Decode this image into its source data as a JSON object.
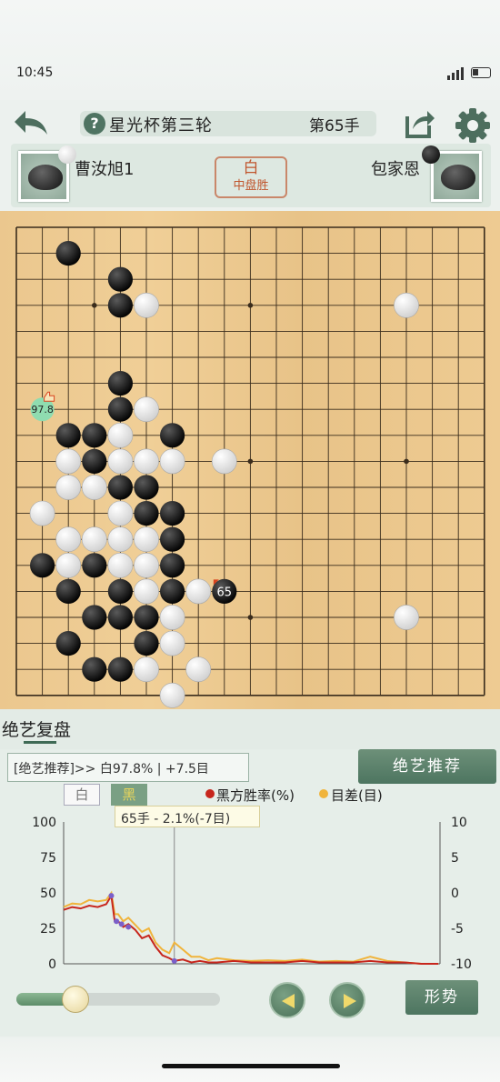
{
  "status": {
    "time": "10:45"
  },
  "header": {
    "title": "星光杯第三轮",
    "move_label": "第65手",
    "help_icon": "?",
    "icons": [
      "back-arrow-icon",
      "share-icon",
      "gear-icon",
      "help-icon"
    ]
  },
  "players": {
    "white": {
      "name": "曹汝旭1",
      "stone": "white"
    },
    "black": {
      "name": "包家恩",
      "stone": "black"
    }
  },
  "result": {
    "winner": "白",
    "method": "中盘胜"
  },
  "board": {
    "size": 19,
    "black_stones": [
      [
        2,
        1
      ],
      [
        4,
        3
      ],
      [
        4,
        2
      ],
      [
        4,
        6
      ],
      [
        4,
        7
      ],
      [
        2,
        8
      ],
      [
        3,
        8
      ],
      [
        6,
        8
      ],
      [
        3,
        9
      ],
      [
        4,
        10
      ],
      [
        5,
        10
      ],
      [
        5,
        11
      ],
      [
        6,
        11
      ],
      [
        6,
        12
      ],
      [
        6,
        13
      ],
      [
        1,
        13
      ],
      [
        3,
        13
      ],
      [
        2,
        14
      ],
      [
        4,
        14
      ],
      [
        6,
        14
      ],
      [
        3,
        15
      ],
      [
        4,
        15
      ],
      [
        5,
        15
      ],
      [
        2,
        16
      ],
      [
        5,
        16
      ],
      [
        3,
        17
      ],
      [
        4,
        17
      ]
    ],
    "white_stones": [
      [
        5,
        3
      ],
      [
        15,
        3
      ],
      [
        5,
        7
      ],
      [
        4,
        8
      ],
      [
        2,
        9
      ],
      [
        4,
        9
      ],
      [
        5,
        9
      ],
      [
        6,
        9
      ],
      [
        8,
        9
      ],
      [
        2,
        10
      ],
      [
        3,
        10
      ],
      [
        1,
        11
      ],
      [
        4,
        11
      ],
      [
        2,
        12
      ],
      [
        3,
        12
      ],
      [
        4,
        12
      ],
      [
        5,
        12
      ],
      [
        4,
        13
      ],
      [
        5,
        13
      ],
      [
        2,
        13
      ],
      [
        5,
        14
      ],
      [
        7,
        14
      ],
      [
        6,
        15
      ],
      [
        15,
        15
      ],
      [
        6,
        16
      ],
      [
        5,
        17
      ],
      [
        7,
        17
      ],
      [
        6,
        18
      ]
    ],
    "last_move": {
      "point": [
        8,
        14
      ],
      "label": "65"
    },
    "hint": {
      "point": [
        1,
        7
      ],
      "label": "97.8"
    }
  },
  "analysis": {
    "section_title": "绝艺复盘",
    "recommendation": "[绝艺推荐]>> 白97.8% | +7.5目",
    "recommend_button": "绝艺推荐",
    "tab_white": "白",
    "tab_black": "黑",
    "legend_winrate": "黑方胜率(%)",
    "legend_score": "目差(目)",
    "tooltip": "65手 - 2.1%(-7目)",
    "colors": {
      "winrate": "#c7261d",
      "score": "#f0b43c",
      "marker": "#7b5fc9"
    }
  },
  "chart_data": {
    "type": "line",
    "x_range": [
      0,
      221
    ],
    "left_axis": {
      "ticks": [
        "100",
        "75",
        "50",
        "25",
        "0"
      ],
      "range": [
        0,
        100
      ]
    },
    "right_axis": {
      "ticks": [
        "10",
        "5",
        "0",
        "-5",
        "-10"
      ],
      "range": [
        -10,
        10
      ]
    },
    "cursor_x": 65,
    "series": [
      {
        "name": "黑方胜率(%)",
        "color": "#c7261d",
        "axis": "left",
        "x": [
          0,
          5,
          10,
          15,
          20,
          25,
          28,
          30,
          32,
          35,
          38,
          42,
          46,
          50,
          54,
          58,
          62,
          65,
          70,
          75,
          80,
          85,
          90,
          100,
          110,
          120,
          130,
          140,
          150,
          160,
          170,
          180,
          190,
          200,
          210,
          220
        ],
        "y": [
          38,
          40,
          39,
          41,
          40,
          42,
          48,
          30,
          30,
          26,
          28,
          24,
          18,
          20,
          12,
          6,
          4,
          2,
          3,
          1,
          2,
          1,
          1,
          2,
          1,
          1,
          1,
          2,
          1,
          1,
          1,
          2,
          1,
          1,
          0,
          0
        ]
      },
      {
        "name": "目差(目)",
        "color": "#f0b43c",
        "axis": "right",
        "x": [
          0,
          5,
          10,
          15,
          20,
          25,
          28,
          30,
          32,
          35,
          38,
          42,
          46,
          50,
          54,
          58,
          62,
          65,
          70,
          75,
          80,
          85,
          90,
          100,
          110,
          120,
          130,
          140,
          150,
          160,
          170,
          180,
          190,
          200,
          210,
          220
        ],
        "y": [
          -2,
          -1.5,
          -1.6,
          -1,
          -1.2,
          -1,
          0,
          -3,
          -3,
          -4,
          -3.5,
          -4.5,
          -5.5,
          -5,
          -7,
          -8,
          -8.5,
          -7,
          -8,
          -9,
          -9,
          -9.5,
          -9.2,
          -9.5,
          -9.6,
          -9.5,
          -9.6,
          -9.4,
          -9.7,
          -9.6,
          -9.7,
          -9,
          -9.6,
          -9.8,
          -10,
          -10
        ]
      }
    ],
    "markers": [
      [
        28,
        48
      ],
      [
        31,
        30
      ],
      [
        34,
        28
      ],
      [
        38,
        26
      ],
      [
        65,
        2
      ]
    ]
  },
  "controls": {
    "shape_button": "形势",
    "progress": 0.29
  }
}
